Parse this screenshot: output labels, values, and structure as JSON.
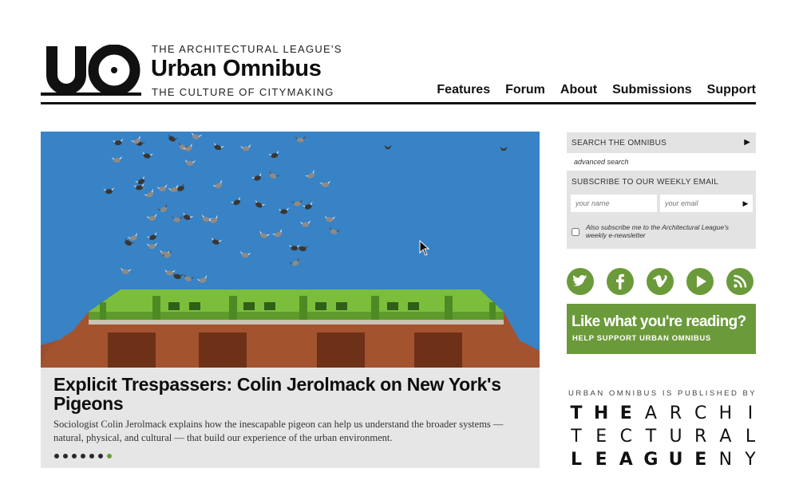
{
  "header": {
    "league_line": "THE ARCHITECTURAL LEAGUE'S",
    "brand": "Urban Omnibus",
    "tagline": "THE CULTURE OF CITYMAKING",
    "nav": [
      "Features",
      "Forum",
      "About",
      "Submissions",
      "Support"
    ]
  },
  "feature": {
    "title": "Explicit Trespassers: Colin Jerolmack on New York's Pigeons",
    "summary": "Sociologist Colin Jerolmack explains how the inescapable pigeon can help us understand the broader systems — natural, physical, and cultural — that build our experience of the urban environment.",
    "slide_count": 7,
    "active_slide": 7,
    "image_colors": {
      "sky": "#3b86c9",
      "cornice": "#7bbe3b",
      "brick": "#a4532f"
    }
  },
  "sidebar": {
    "search_label": "SEARCH THE OMNIBUS",
    "advanced_search": "advanced search",
    "subscribe_label": "SUBSCRIBE TO OUR WEEKLY EMAIL",
    "name_placeholder": "your name",
    "email_placeholder": "your email",
    "checkbox_label": "Also subscribe me to the Architectural League's weekly e-newsletter",
    "social_icons": [
      "twitter-icon",
      "facebook-icon",
      "vimeo-icon",
      "youtube-play-icon",
      "rss-icon"
    ],
    "support_headline": "Like what you're reading?",
    "support_sub": "HELP SUPPORT URBAN OMNIBUS",
    "published_by": "URBAN OMNIBUS IS PUBLISHED BY",
    "league_rows": [
      "THEARCHI",
      "TECTURAL",
      "LEAGUENY"
    ]
  },
  "colors": {
    "accent_green": "#6b9a3a",
    "panel_gray": "#e3e3e3",
    "feature_gray": "#e6e6e6"
  }
}
